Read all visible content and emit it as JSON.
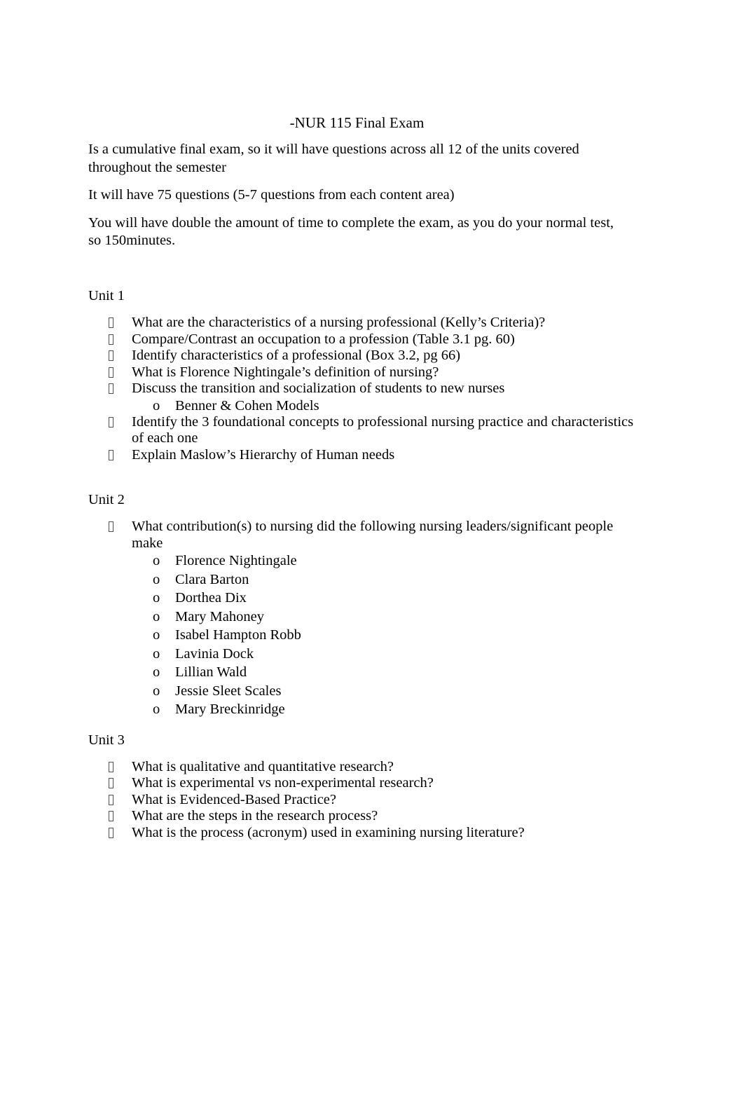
{
  "document": {
    "title": "-NUR 115 Final Exam",
    "intro_paragraphs": [
      "Is a cumulative final exam, so it will have questions across all 12 of the units covered throughout the semester",
      "It will have 75 questions (5-7 questions from each content area)",
      "You will have double the amount of time to complete the exam, as you do your normal test, so 150minutes."
    ],
    "bullet_marker": "□",
    "sub_bullet_marker": "o",
    "units": [
      {
        "heading": "Unit 1",
        "items": [
          {
            "text": "What are the characteristics of a nursing professional (Kelly’s Criteria)?",
            "subitems": []
          },
          {
            "text": "Compare/Contrast an occupation to a profession (Table 3.1 pg. 60)",
            "subitems": []
          },
          {
            "text": "Identify characteristics of a professional (Box 3.2, pg 66)",
            "subitems": []
          },
          {
            "text": "What is Florence Nightingale’s definition of nursing?",
            "subitems": []
          },
          {
            "text": "Discuss the transition and socialization of students to new nurses",
            "subitems": [
              "Benner & Cohen Models"
            ]
          },
          {
            "text": "Identify the 3 foundational concepts to professional nursing practice and characteristics of each one",
            "subitems": []
          },
          {
            "text": "Explain Maslow’s Hierarchy of Human needs",
            "subitems": []
          }
        ]
      },
      {
        "heading": "Unit 2",
        "items": [
          {
            "text": "What contribution(s) to nursing did the following nursing leaders/significant people make",
            "subitems": [
              "Florence Nightingale",
              "Clara Barton",
              "Dorthea Dix",
              "Mary Mahoney",
              "Isabel Hampton Robb",
              "Lavinia Dock",
              "Lillian Wald",
              "Jessie Sleet Scales",
              "Mary Breckinridge"
            ]
          }
        ]
      },
      {
        "heading": "Unit 3",
        "items": [
          {
            "text": "What is qualitative and quantitative research?",
            "subitems": []
          },
          {
            "text": "What is experimental vs non-experimental research?",
            "subitems": []
          },
          {
            "text": "What is Evidenced-Based Practice?",
            "subitems": []
          },
          {
            "text": "What are the steps in the research process?",
            "subitems": []
          },
          {
            "text": "What is the process (acronym) used in examining nursing literature?",
            "subitems": []
          }
        ]
      }
    ]
  }
}
